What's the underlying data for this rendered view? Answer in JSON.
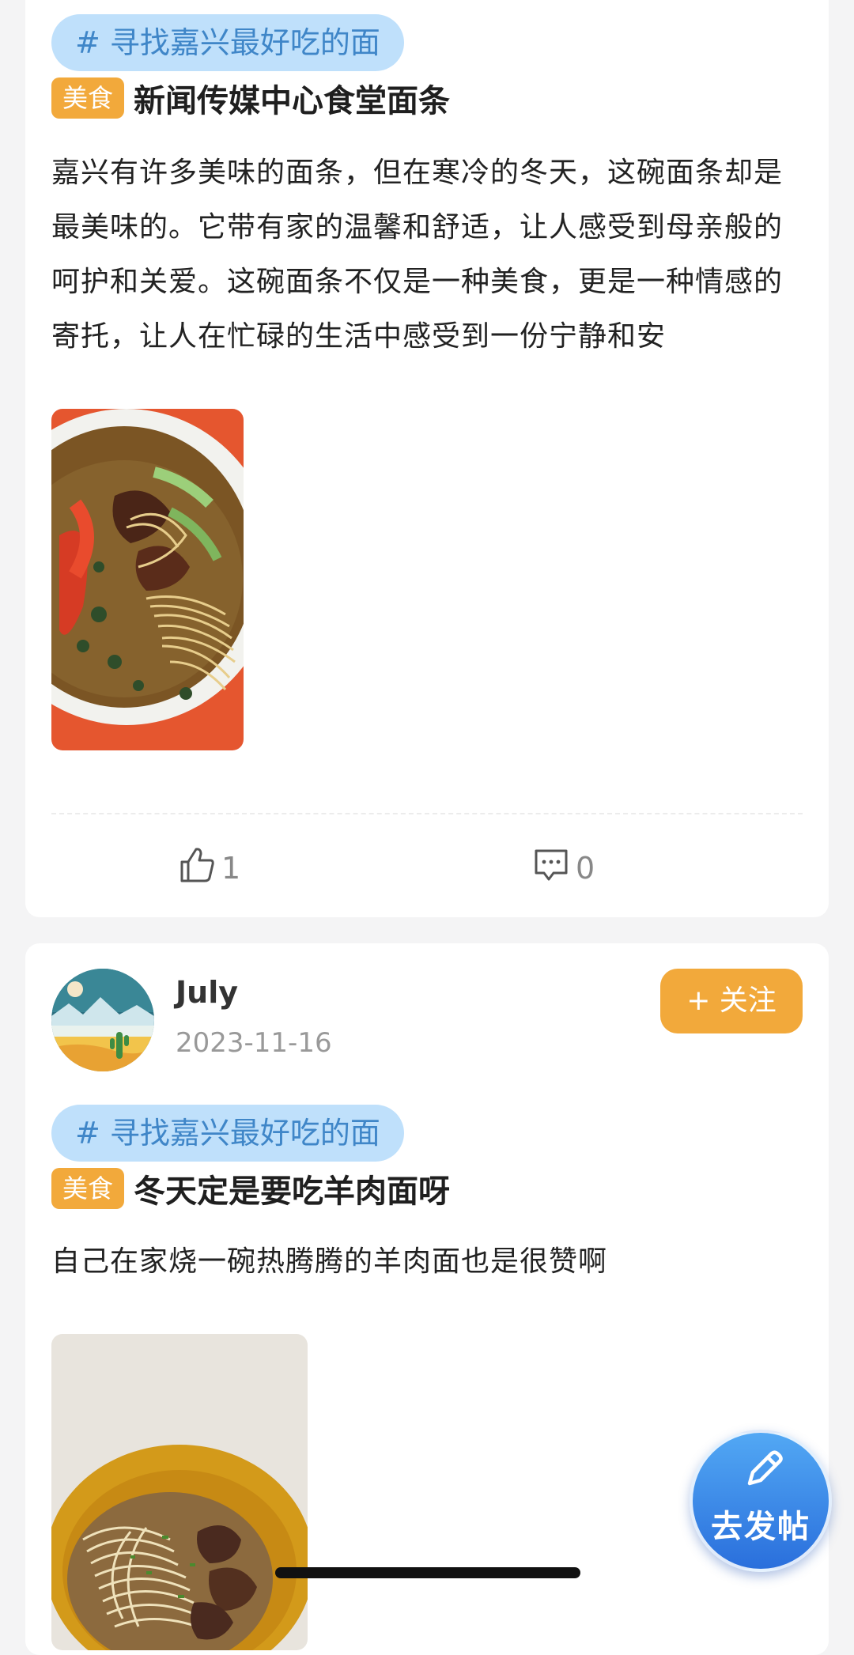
{
  "posts": [
    {
      "topic": "# 寻找嘉兴最好吃的面",
      "category": "美食",
      "title": "新闻传媒中心食堂面条",
      "body": "嘉兴有许多美味的面条，但在寒冷的冬天，这碗面条却是最美味的。它带有家的温馨和舒适，让人感受到母亲般的呵护和关爱。这碗面条不仅是一种美食，更是一种情感的寄托，让人在忙碌的生活中感受到一份宁静和安",
      "likes": "1",
      "comments": "0"
    },
    {
      "author": "July",
      "date": "2023-11-16",
      "follow_label": "+ 关注",
      "topic": "# 寻找嘉兴最好吃的面",
      "category": "美食",
      "title": "冬天定是要吃羊肉面呀",
      "body": "自己在家烧一碗热腾腾的羊肉面也是很赞啊"
    }
  ],
  "fab": {
    "label": "去发帖",
    "icon": "pencil-icon"
  },
  "colors": {
    "accent_orange": "#f2a93b",
    "topic_bg": "#bfe0fb",
    "topic_text": "#3f86c8",
    "fab_blue": "#2a6fdc"
  }
}
